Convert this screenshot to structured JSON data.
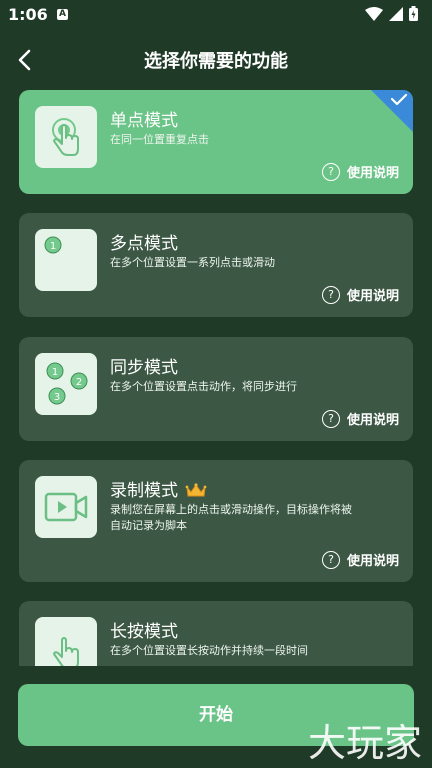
{
  "status": {
    "time": "1:06",
    "notif_letter": "A"
  },
  "header": {
    "title": "选择你需要的功能"
  },
  "cards": [
    {
      "title": "单点模式",
      "desc": "在同一位置重复点击",
      "help": "使用说明",
      "selected": true
    },
    {
      "title": "多点模式",
      "desc": "在多个位置设置一系列点击或滑动",
      "help": "使用说明"
    },
    {
      "title": "同步模式",
      "desc": "在多个位置设置点击动作，将同步进行",
      "help": "使用说明"
    },
    {
      "title": "录制模式",
      "desc": "录制您在屏幕上的点击或滑动操作，目标操作将被自动记录为脚本",
      "help": "使用说明",
      "crown_icon": "crown-icon"
    },
    {
      "title": "长按模式",
      "desc": "在多个位置设置长按动作并持续一段时间"
    }
  ],
  "marker_numbers": [
    "1",
    "1",
    "2",
    "3"
  ],
  "start_button": {
    "label": "开始"
  },
  "watermark": {
    "text": "大玩家"
  },
  "colors": {
    "background": "#1f3a27",
    "card": "#3c5844",
    "accent": "#6bc487",
    "selected_corner": "#3b8ad9"
  }
}
